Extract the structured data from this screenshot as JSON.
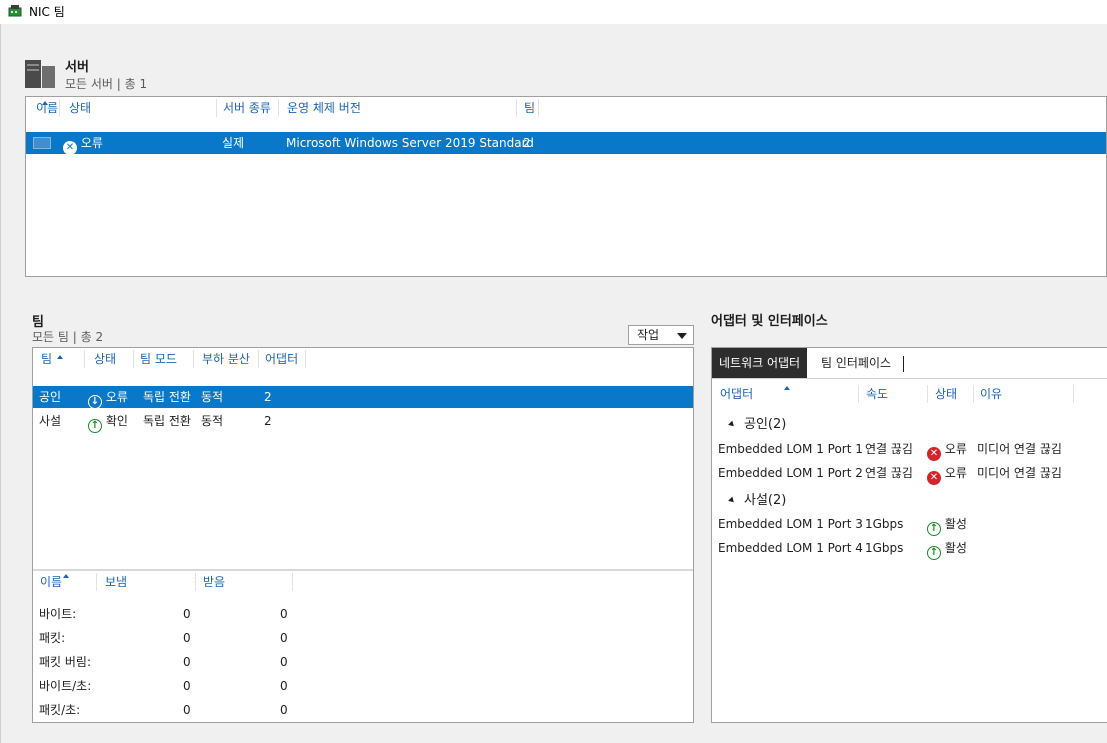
{
  "window": {
    "title": "NIC 팀"
  },
  "servers": {
    "title": "서버",
    "subtitle": "모든 서버 | 총 1",
    "columns": [
      "이름",
      "상태",
      "서버 종류",
      "운영 체제 버전",
      "팀"
    ],
    "rows": [
      {
        "name": "",
        "status": "오류",
        "type": "실제",
        "os": "Microsoft Windows Server 2019 Standard",
        "teams": "2"
      }
    ]
  },
  "teams": {
    "title": "팀",
    "subtitle": "모든 팀 | 총 2",
    "tasks_label": "작업",
    "columns": [
      "팀",
      "상태",
      "팀 모드",
      "부하 분산",
      "어댑터"
    ],
    "rows": [
      {
        "name": "공인",
        "status": "오류",
        "mode": "독립 전환",
        "balance": "동적",
        "adapters": "2",
        "state": "error"
      },
      {
        "name": "사설",
        "status": "확인",
        "mode": "독립 전환",
        "balance": "동적",
        "adapters": "2",
        "state": "ok"
      }
    ],
    "stats": {
      "columns": [
        "이름",
        "보냄",
        "받음"
      ],
      "rows": [
        {
          "label": "바이트:",
          "sent": "0",
          "recv": "0"
        },
        {
          "label": "패킷:",
          "sent": "0",
          "recv": "0"
        },
        {
          "label": "패킷 버림:",
          "sent": "0",
          "recv": "0"
        },
        {
          "label": "바이트/초:",
          "sent": "0",
          "recv": "0"
        },
        {
          "label": "패킷/초:",
          "sent": "0",
          "recv": "0"
        }
      ]
    }
  },
  "adapters": {
    "title": "어댑터 및 인터페이스",
    "tabs": [
      "네트워크 어댑터",
      "팀 인터페이스"
    ],
    "columns": [
      "어댑터",
      "속도",
      "상태",
      "이유"
    ],
    "groups": [
      {
        "name": "공인(2)",
        "items": [
          {
            "adapter": "Embedded LOM 1 Port 1",
            "speed": "연결 끊김",
            "status": "오류",
            "reason": "미디어 연결 끊김",
            "state": "error"
          },
          {
            "adapter": "Embedded LOM 1 Port 2",
            "speed": "연결 끊김",
            "status": "오류",
            "reason": "미디어 연결 끊김",
            "state": "error"
          }
        ]
      },
      {
        "name": "사설(2)",
        "items": [
          {
            "adapter": "Embedded LOM 1 Port 3",
            "speed": "1Gbps",
            "status": "활성",
            "reason": "",
            "state": "ok"
          },
          {
            "adapter": "Embedded LOM 1 Port 4",
            "speed": "1Gbps",
            "status": "활성",
            "reason": "",
            "state": "ok"
          }
        ]
      }
    ]
  },
  "icons": {
    "app": "nic-team-icon",
    "server_section": "server-icon",
    "error": "error-circle-icon",
    "down": "arrow-down-circle-icon",
    "up": "arrow-up-circle-icon"
  },
  "colors": {
    "selection": "#0a78c8",
    "header_text": "#1e64b4",
    "error": "#d4242b",
    "ok": "#1a8a2a"
  }
}
